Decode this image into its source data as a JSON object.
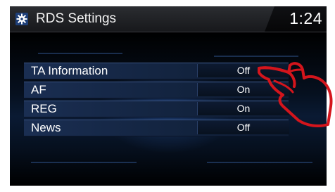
{
  "header": {
    "title": "RDS Settings",
    "clock": "1:24",
    "icon": "gear-icon"
  },
  "settings": [
    {
      "label": "TA Information",
      "value": "Off"
    },
    {
      "label": "AF",
      "value": "On"
    },
    {
      "label": "REG",
      "value": "On"
    },
    {
      "label": "News",
      "value": "Off"
    }
  ],
  "overlay": {
    "icon": "touch-hand-icon",
    "color": "#d4151c"
  }
}
